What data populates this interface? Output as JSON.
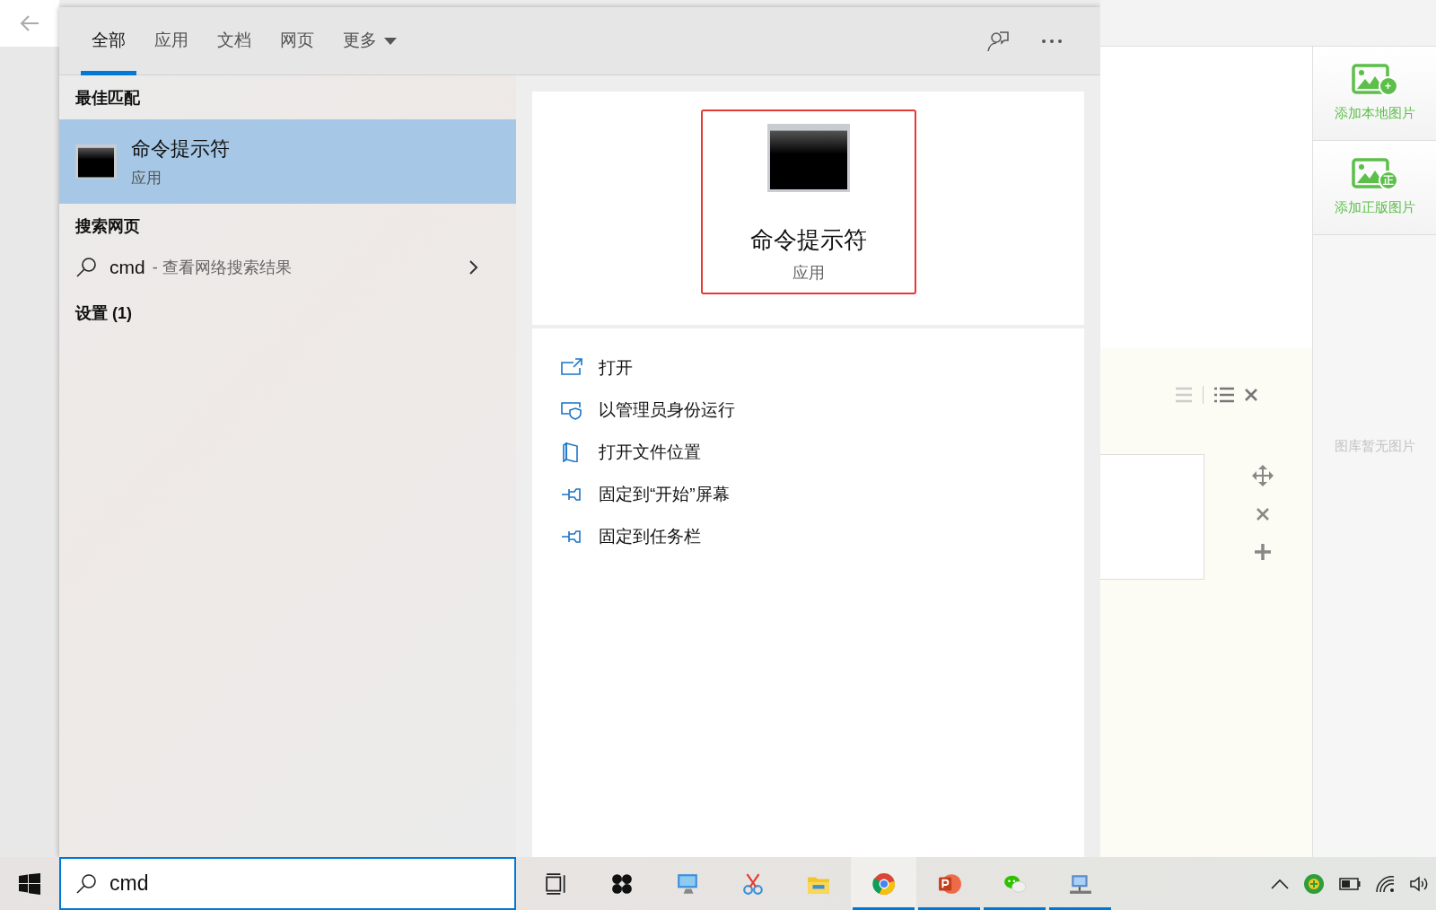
{
  "tabs": [
    {
      "label": "全部",
      "selected": true,
      "kind": "plain"
    },
    {
      "label": "应用",
      "selected": false,
      "kind": "plain"
    },
    {
      "label": "文档",
      "selected": false,
      "kind": "plain"
    },
    {
      "label": "网页",
      "selected": false,
      "kind": "plain"
    },
    {
      "label": "更多",
      "selected": false,
      "kind": "dropdown"
    }
  ],
  "best_match": {
    "heading": "最佳匹配",
    "item": {
      "title": "命令提示符",
      "subtitle": "应用",
      "selected": true
    }
  },
  "web_search": {
    "heading": "搜索网页",
    "query": "cmd",
    "hint": "- 查看网络搜索结果"
  },
  "settings": {
    "heading": "设置 (1)"
  },
  "preview": {
    "title": "命令提示符",
    "subtitle": "应用"
  },
  "actions": [
    {
      "label": "打开",
      "kind": "open"
    },
    {
      "label": "以管理员身份运行",
      "kind": "admin"
    },
    {
      "label": "打开文件位置",
      "kind": "folder"
    },
    {
      "label": "固定到“开始”屏幕",
      "kind": "pin"
    },
    {
      "label": "固定到任务栏",
      "kind": "pin"
    }
  ],
  "search_box": {
    "value": "cmd"
  },
  "taskbar": {
    "apps": [
      {
        "kind": "taskview",
        "running": false,
        "active": false
      },
      {
        "kind": "pinwheel",
        "running": false,
        "active": false
      },
      {
        "kind": "computer",
        "running": false,
        "active": false
      },
      {
        "kind": "scissors",
        "running": false,
        "active": false
      },
      {
        "kind": "explorer",
        "running": false,
        "active": false
      },
      {
        "kind": "chrome",
        "running": true,
        "active": true
      },
      {
        "kind": "powerpoint",
        "running": true,
        "active": false
      },
      {
        "kind": "wechat",
        "running": true,
        "active": false
      },
      {
        "kind": "network",
        "running": true,
        "active": false
      }
    ]
  },
  "sidebar": {
    "buttons": [
      {
        "label": "添加本地图片",
        "badge": "+"
      },
      {
        "label": "添加正版图片",
        "badge": "正"
      }
    ],
    "empty_text": "图库暂无图片"
  }
}
